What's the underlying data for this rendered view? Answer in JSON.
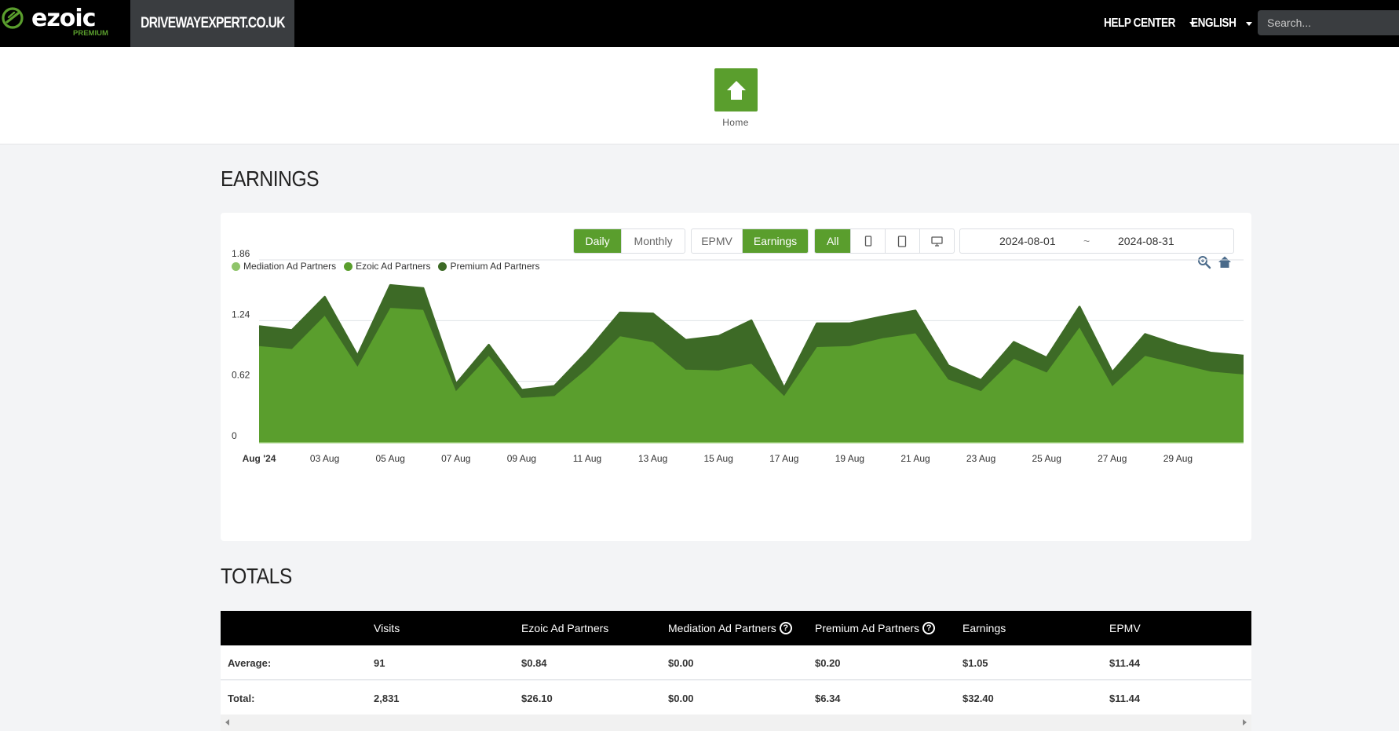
{
  "brand": {
    "name": "ezoic",
    "tier": "PREMIUM",
    "accent": "#5a9e2d"
  },
  "nav": {
    "site": "DRIVEWAYEXPERT.CO.UK",
    "help_center": "HELP CENTER",
    "language": "ENGLISH",
    "search_placeholder": "Search..."
  },
  "home": {
    "label": "Home",
    "icon": "home-icon"
  },
  "earnings": {
    "title": "EARNINGS",
    "period_buttons": [
      "Daily",
      "Monthly"
    ],
    "metric_buttons": [
      "EPMV",
      "Earnings"
    ],
    "device_all": "All",
    "device_icons": [
      "phone-icon",
      "tablet-icon",
      "desktop-icon"
    ],
    "date_from": "2024-08-01",
    "date_sep": "~",
    "date_to": "2024-08-31"
  },
  "chart_data": {
    "type": "area",
    "stacked": true,
    "title": "",
    "xlabel": "",
    "ylabel": "",
    "ylim": [
      0,
      1.86
    ],
    "y_ticks": [
      "0",
      "0.62",
      "1.24",
      "1.86"
    ],
    "x_tick_labels": [
      "Aug '24",
      "03 Aug",
      "05 Aug",
      "07 Aug",
      "09 Aug",
      "11 Aug",
      "13 Aug",
      "15 Aug",
      "17 Aug",
      "19 Aug",
      "21 Aug",
      "23 Aug",
      "25 Aug",
      "27 Aug",
      "29 Aug"
    ],
    "x": [
      "2024-08-01",
      "2024-08-02",
      "2024-08-03",
      "2024-08-04",
      "2024-08-05",
      "2024-08-06",
      "2024-08-07",
      "2024-08-08",
      "2024-08-09",
      "2024-08-10",
      "2024-08-11",
      "2024-08-12",
      "2024-08-13",
      "2024-08-14",
      "2024-08-15",
      "2024-08-16",
      "2024-08-17",
      "2024-08-18",
      "2024-08-19",
      "2024-08-20",
      "2024-08-21",
      "2024-08-22",
      "2024-08-23",
      "2024-08-24",
      "2024-08-25",
      "2024-08-26",
      "2024-08-27",
      "2024-08-28",
      "2024-08-29",
      "2024-08-30",
      "2024-08-31"
    ],
    "series": [
      {
        "name": "Mediation Ad Partners",
        "color": "#8fc46a",
        "values": [
          0,
          0,
          0,
          0,
          0,
          0,
          0,
          0,
          0,
          0,
          0,
          0,
          0,
          0,
          0,
          0,
          0,
          0,
          0,
          0,
          0,
          0,
          0,
          0,
          0,
          0,
          0,
          0,
          0,
          0,
          0
        ]
      },
      {
        "name": "Ezoic Ad Partners",
        "color": "#5a9e2d",
        "values": [
          0.98,
          0.95,
          1.29,
          0.77,
          1.37,
          1.35,
          0.52,
          0.88,
          0.45,
          0.47,
          0.75,
          1.08,
          1.02,
          0.74,
          0.73,
          0.8,
          0.47,
          0.97,
          0.98,
          1.06,
          1.11,
          0.64,
          0.52,
          0.85,
          0.71,
          1.17,
          0.57,
          0.88,
          0.8,
          0.72,
          0.69
        ]
      },
      {
        "name": "Premium Ad Partners",
        "color": "#3d6a26",
        "values": [
          0.2,
          0.19,
          0.19,
          0.11,
          0.23,
          0.22,
          0.07,
          0.11,
          0.08,
          0.1,
          0.17,
          0.24,
          0.29,
          0.3,
          0.35,
          0.44,
          0.08,
          0.24,
          0.23,
          0.22,
          0.23,
          0.14,
          0.11,
          0.17,
          0.15,
          0.21,
          0.14,
          0.22,
          0.19,
          0.19,
          0.19
        ]
      }
    ]
  },
  "totals": {
    "title": "TOTALS",
    "headers": [
      "",
      "Visits",
      "Ezoic Ad Partners",
      "Mediation Ad Partners",
      "Premium Ad Partners",
      "Earnings",
      "EPMV"
    ],
    "rows": [
      [
        "Average:",
        "91",
        "$0.84",
        "$0.00",
        "$0.20",
        "$1.05",
        "$11.44"
      ],
      [
        "Total:",
        "2,831",
        "$26.10",
        "$0.00",
        "$6.34",
        "$32.40",
        "$11.44"
      ]
    ]
  }
}
